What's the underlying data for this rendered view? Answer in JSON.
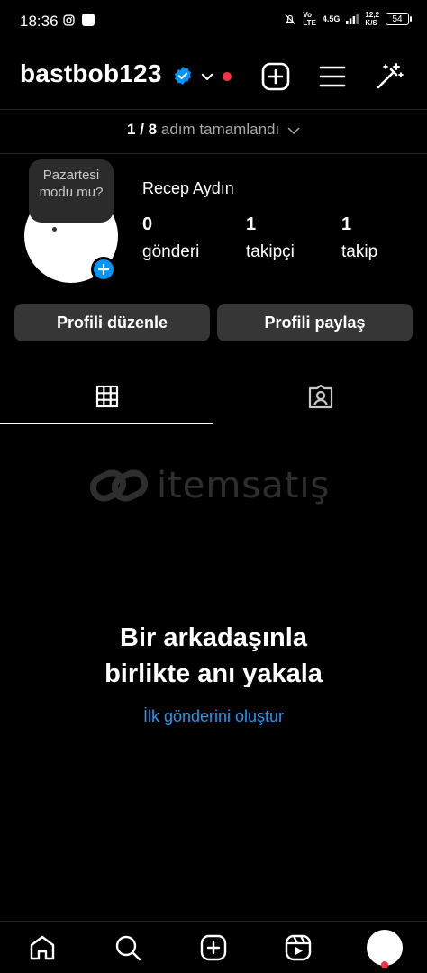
{
  "status_bar": {
    "time": "18:36",
    "network_top": "Vo",
    "network_bottom": "LTE",
    "signal": "4.5G",
    "speed_top": "12,2",
    "speed_bottom": "K/S",
    "battery": "54"
  },
  "header": {
    "username": "bastbob123",
    "icons": [
      "verified-icon",
      "chevron-down-icon",
      "new-post-icon",
      "menu-icon",
      "magic-wand-icon"
    ],
    "accent_color": "#0095f6",
    "notification_color": "#ff3040"
  },
  "steps": {
    "count": "1 / 8",
    "label": "adım tamamlandı"
  },
  "profile": {
    "tooltip": "Pazartesi modu mu?",
    "full_name": "Recep Aydın",
    "stats": [
      {
        "value": "0",
        "label": "gönderi"
      },
      {
        "value": "1",
        "label": "takipçi"
      },
      {
        "value": "1",
        "label": "takip"
      }
    ],
    "edit_button": "Profili düzenle",
    "share_button": "Profili paylaş"
  },
  "tabs": [
    {
      "icon": "grid-icon",
      "active": true
    },
    {
      "icon": "tagged-icon",
      "active": false
    }
  ],
  "watermark": {
    "text": "itemsatış"
  },
  "empty_state": {
    "title_line1": "Bir arkadaşınla",
    "title_line2": "birlikte anı yakala",
    "link": "İlk gönderini oluştur",
    "link_color": "#1a9cf2"
  },
  "bottom_nav": [
    "home-icon",
    "search-icon",
    "create-icon",
    "reels-icon",
    "profile-avatar"
  ]
}
